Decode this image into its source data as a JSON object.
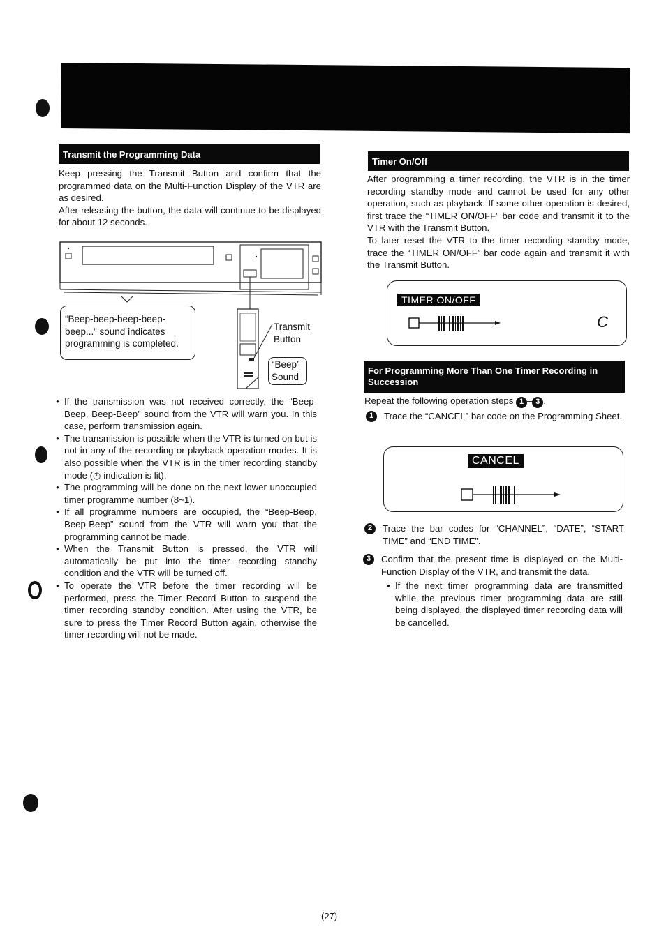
{
  "page_number": "(27)",
  "left": {
    "heading": "Transmit the Programming Data",
    "intro": [
      "Keep pressing the Transmit Button and confirm that the programmed data on the Multi-Function Display of the VTR are as desired.",
      "After releasing the button, the data will continue to be displayed for about 12 seconds."
    ],
    "figure": {
      "bubble_text": "“Beep-beep-beep-beep-beep...” sound indicates programming is completed.",
      "transmit_label_1": "Transmit",
      "transmit_label_2": "Button",
      "beep_label_1": "“Beep”",
      "beep_label_2": "Sound"
    },
    "bullets": [
      "If the transmission was not received correctly, the “Beep-Beep, Beep-Beep” sound from the VTR will warn you. In this case, perform transmission again.",
      "The transmission is possible when the VTR is turned on but is not in any of the recording or playback operation modes. It is also possible when the VTR is in the timer recording standby mode (◷ indication is lit).",
      "The programming will be done on the next lower unoccupied timer programme number (8~1).",
      "If all programme numbers are occupied, the “Beep-Beep, Beep-Beep” sound from the VTR will warn you that the programming cannot be made.",
      "When the Transmit Button is pressed, the VTR will automatically be put into the timer recording standby condition and the VTR will be turned off.",
      "To operate the VTR before the timer recording will be performed, press the Timer Record Button to suspend the timer recording standby condition. After using the VTR, be sure to press the Timer Record Button again, otherwise the timer recording will not be made."
    ]
  },
  "right": {
    "timer_heading": "Timer On/Off",
    "timer_paras": [
      "After programming a timer recording, the VTR is in the timer recording standby mode and cannot be used for any other operation, such as playback. If some other operation is desired, first trace the “TIMER ON/OFF” bar code and transmit it to the VTR with the Transmit Button.",
      "To later reset the VTR to the timer recording standby mode, trace the “TIMER ON/OFF” bar code again and transmit it with the Transmit Button."
    ],
    "timer_barcode_label": "TIMER ON/OFF",
    "timer_barcode_display": "C",
    "succession_heading": "For Programming More Than One Timer Recording in Succession",
    "succession_intro": "Repeat the following operation steps",
    "succession_intro_range": [
      "1",
      "3"
    ],
    "steps": [
      {
        "num": "1",
        "text": "Trace the “CANCEL” bar code on the Programming Sheet."
      },
      {
        "num": "2",
        "text": "Trace the bar codes for “CHANNEL”, “DATE”, “START TIME” and “END TIME”."
      },
      {
        "num": "3",
        "text": "Confirm that the present time is displayed on the Multi-Function Display of the VTR, and transmit the data."
      }
    ],
    "cancel_barcode_label": "CANCEL",
    "step3_bullet": "If the next timer programming data are transmitted while the previous timer programming data are still being displayed, the displayed timer recording data will be cancelled."
  }
}
